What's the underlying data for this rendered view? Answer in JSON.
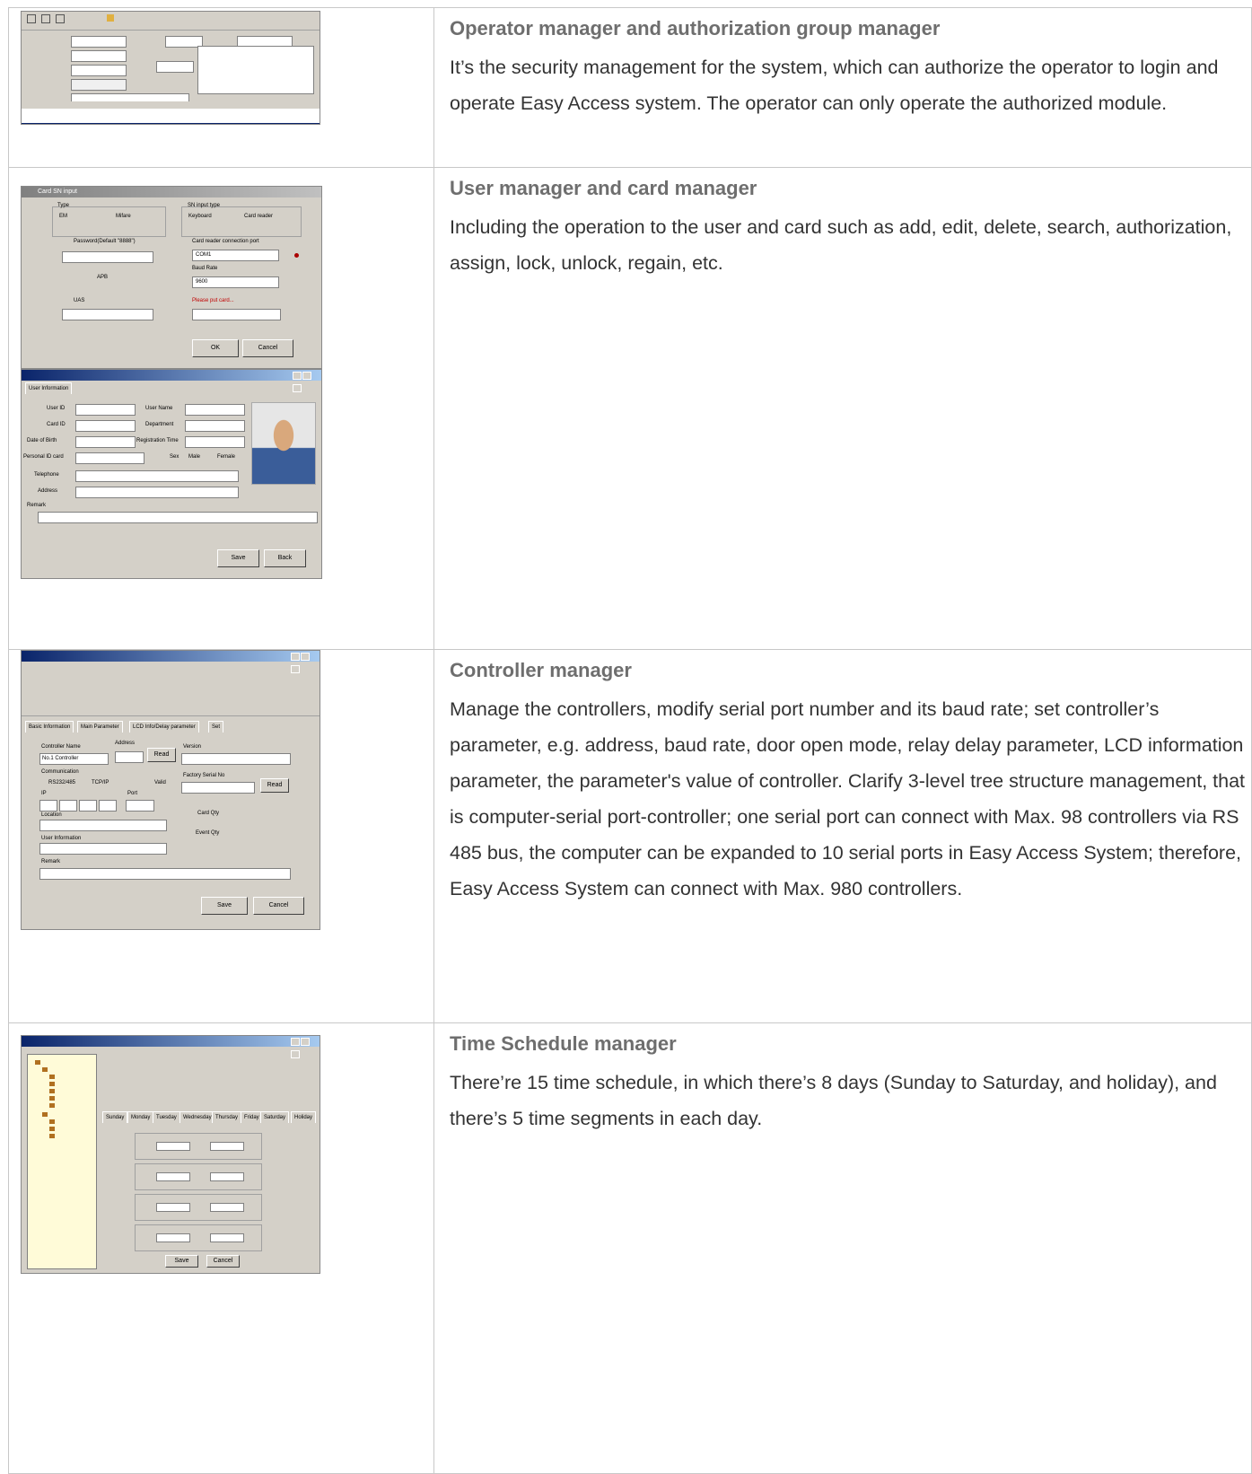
{
  "rows": [
    {
      "title": "Operator manager and authorization group manager",
      "description": "It’s the security management for the system, which can authorize the operator to login and operate Easy Access system. The operator can only operate the authorized module."
    },
    {
      "title": "User manager and card manager",
      "description": "Including the operation to the user and card such as add, edit, delete, search, authorization, assign, lock, unlock, regain, etc."
    },
    {
      "title": "Controller manager",
      "description": "Manage the controllers, modify serial port number and its baud rate; set controller’s parameter, e.g. address, baud rate, door open mode, relay delay parameter, LCD information parameter, the parameter's value of controller. Clarify 3-level tree structure management, that is computer-serial port-controller; one serial port can connect with Max. 98 controllers via RS 485 bus, the computer can be expanded to 10 serial ports in Easy Access System; therefore, Easy Access System can connect with Max. 980 controllers."
    },
    {
      "title": "Time Schedule manager",
      "description": "There’re 15 time schedule, in which there’s 8 days (Sunday to Saturday, and holiday), and there’s 5 time segments in each day."
    }
  ],
  "screens": {
    "card_input": {
      "title": "Card SN input",
      "type_label": "Type",
      "em": "EM",
      "mifare": "Mifare",
      "sn_type_label": "SN input type",
      "keyboard": "Keyboard",
      "card_reader": "Card reader",
      "password_label": "Password(Default \"8888\")",
      "port_label": "Card reader connection port",
      "port_value": "COM1",
      "apb": "APB",
      "baud_label": "Baud Rate",
      "baud_value": "9600",
      "uas_label": "UAS",
      "please_put": "Please put card...",
      "ok": "OK",
      "cancel": "Cancel"
    },
    "user_info": {
      "tab": "User Information",
      "user_id": "User ID",
      "user_name": "User Name",
      "card_id": "Card ID",
      "department": "Department",
      "dob": "Date of Birth",
      "reg_time": "Registration Time",
      "personal_id": "Personal ID card",
      "sex": "Sex",
      "male": "Male",
      "female": "Female",
      "telephone": "Telephone",
      "address": "Address",
      "remark": "Remark",
      "save": "Save",
      "back": "Back"
    },
    "controller": {
      "tabs": [
        "Basic Information",
        "Main Parameter",
        "LCD Info/Delay parameter",
        "Set"
      ],
      "controller_name": "Controller Name",
      "controller_name_value": "No.1 Controller",
      "address": "Address",
      "version": "Version",
      "read": "Read",
      "communication": "Communication",
      "rs232": "RS232/485",
      "tcpip": "TCP/IP",
      "valid": "Valid",
      "factory_serial": "Factory Serial No",
      "ip": "IP",
      "port": "Port",
      "card_qty": "Card Qty",
      "event_qty": "Event Qty",
      "location": "Location",
      "user_information": "User Information",
      "remark": "Remark",
      "save": "Save",
      "cancel": "Cancel"
    },
    "schedule": {
      "tabs": [
        "Sunday",
        "Monday",
        "Tuesday",
        "Wednesday",
        "Thursday",
        "Friday",
        "Saturday",
        "Holiday"
      ],
      "save": "Save",
      "cancel": "Cancel"
    }
  }
}
